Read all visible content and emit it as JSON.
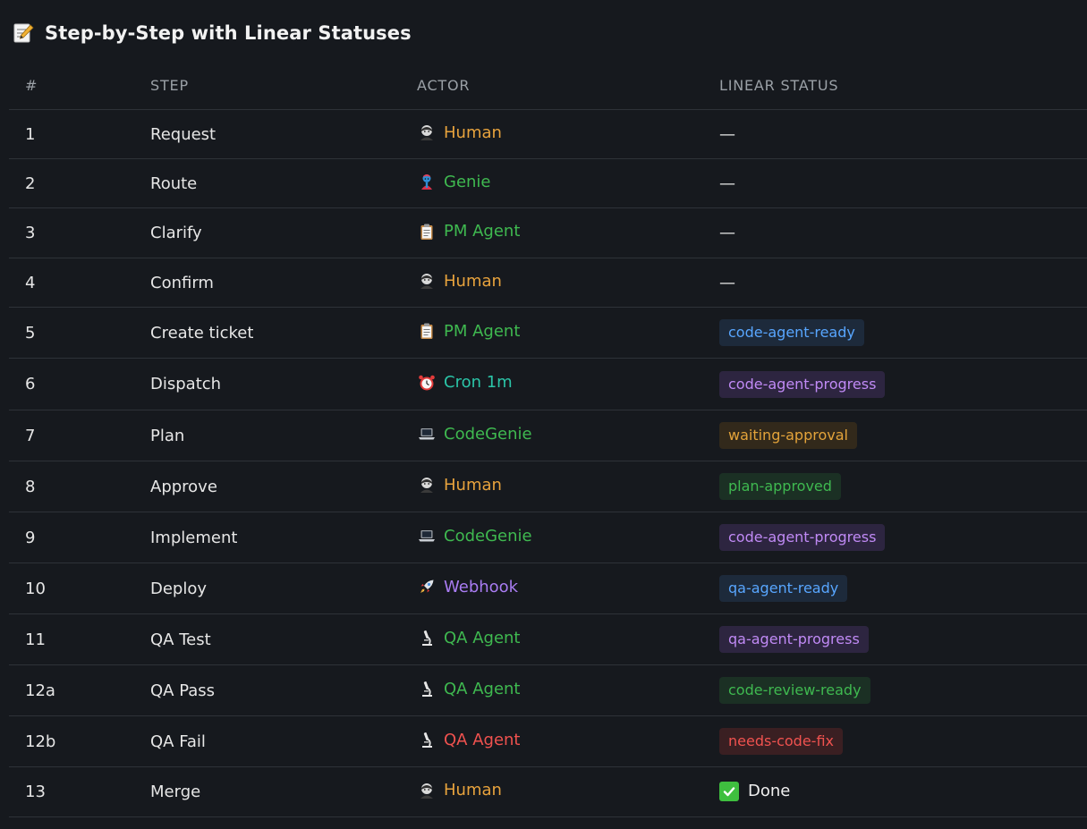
{
  "header": {
    "title": "Step-by-Step with Linear Statuses",
    "icon": "memo-icon"
  },
  "table": {
    "columns": [
      "#",
      "STEP",
      "ACTOR",
      "LINEAR STATUS"
    ],
    "rows": [
      {
        "num": "1",
        "step": "Request",
        "actor": "Human",
        "actor_icon": "person-icon",
        "actor_color": "#e8a33d",
        "status_type": "dash",
        "status": "—"
      },
      {
        "num": "2",
        "step": "Route",
        "actor": "Genie",
        "actor_icon": "genie-icon",
        "actor_color": "#3fb950",
        "status_type": "dash",
        "status": "—"
      },
      {
        "num": "3",
        "step": "Clarify",
        "actor": "PM Agent",
        "actor_icon": "clipboard-icon",
        "actor_color": "#3fb950",
        "status_type": "dash",
        "status": "—"
      },
      {
        "num": "4",
        "step": "Confirm",
        "actor": "Human",
        "actor_icon": "person-icon",
        "actor_color": "#e8a33d",
        "status_type": "dash",
        "status": "—"
      },
      {
        "num": "5",
        "step": "Create ticket",
        "actor": "PM Agent",
        "actor_icon": "clipboard-icon",
        "actor_color": "#3fb950",
        "status_type": "badge",
        "status": "code-agent-ready",
        "badge_fg": "#58a6ff",
        "badge_bg": "#1d2a3b"
      },
      {
        "num": "6",
        "step": "Dispatch",
        "actor": "Cron 1m",
        "actor_icon": "alarm-clock-icon",
        "actor_color": "#2bc5a8",
        "status_type": "badge",
        "status": "code-agent-progress",
        "badge_fg": "#c08af5",
        "badge_bg": "#2d2540"
      },
      {
        "num": "7",
        "step": "Plan",
        "actor": "CodeGenie",
        "actor_icon": "laptop-icon",
        "actor_color": "#3fb950",
        "status_type": "badge",
        "status": "waiting-approval",
        "badge_fg": "#e3a33a",
        "badge_bg": "#32291b"
      },
      {
        "num": "8",
        "step": "Approve",
        "actor": "Human",
        "actor_icon": "person-icon",
        "actor_color": "#e8a33d",
        "status_type": "badge",
        "status": "plan-approved",
        "badge_fg": "#3fb950",
        "badge_bg": "#1b3024"
      },
      {
        "num": "9",
        "step": "Implement",
        "actor": "CodeGenie",
        "actor_icon": "laptop-icon",
        "actor_color": "#3fb950",
        "status_type": "badge",
        "status": "code-agent-progress",
        "badge_fg": "#c08af5",
        "badge_bg": "#2d2540"
      },
      {
        "num": "10",
        "step": "Deploy",
        "actor": "Webhook",
        "actor_icon": "rocket-icon",
        "actor_color": "#a97cf2",
        "status_type": "badge",
        "status": "qa-agent-ready",
        "badge_fg": "#58a6ff",
        "badge_bg": "#1d2a3b"
      },
      {
        "num": "11",
        "step": "QA Test",
        "actor": "QA Agent",
        "actor_icon": "microscope-icon",
        "actor_color": "#3fb950",
        "status_type": "badge",
        "status": "qa-agent-progress",
        "badge_fg": "#c08af5",
        "badge_bg": "#2d2540"
      },
      {
        "num": "12a",
        "step": "QA Pass",
        "actor": "QA Agent",
        "actor_icon": "microscope-icon",
        "actor_color": "#3fb950",
        "status_type": "badge",
        "status": "code-review-ready",
        "badge_fg": "#3fb950",
        "badge_bg": "#1b3024"
      },
      {
        "num": "12b",
        "step": "QA Fail",
        "actor": "QA Agent",
        "actor_icon": "microscope-icon",
        "actor_color": "#f0524f",
        "status_type": "badge",
        "status": "needs-code-fix",
        "badge_fg": "#f0524f",
        "badge_bg": "#3a1f22"
      },
      {
        "num": "13",
        "step": "Merge",
        "actor": "Human",
        "actor_icon": "person-icon",
        "actor_color": "#e8a33d",
        "status_type": "done",
        "status": "Done"
      }
    ]
  }
}
